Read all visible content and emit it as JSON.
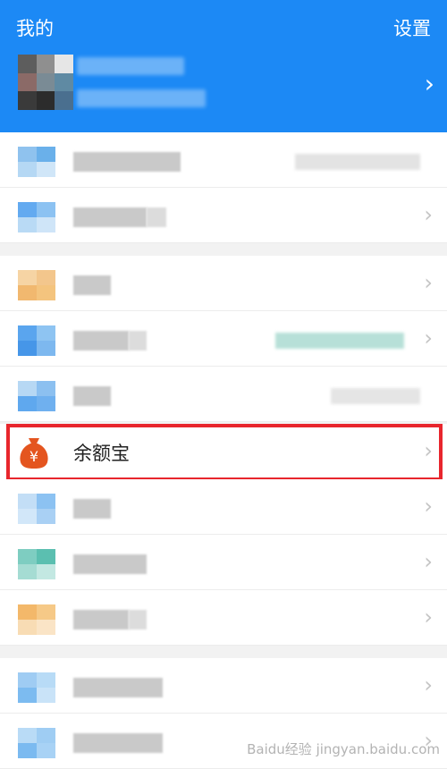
{
  "header": {
    "title": "我的",
    "settings_label": "设置"
  },
  "highlighted_item": {
    "label": "余额宝",
    "icon": "money-bag-icon",
    "icon_glyph": "¥"
  },
  "colors": {
    "header_bg": "#1c89f5",
    "highlight_border": "#e8262d",
    "money_bag": "#e4551f"
  },
  "watermark": "Baidu经验 jingyan.baidu.com"
}
